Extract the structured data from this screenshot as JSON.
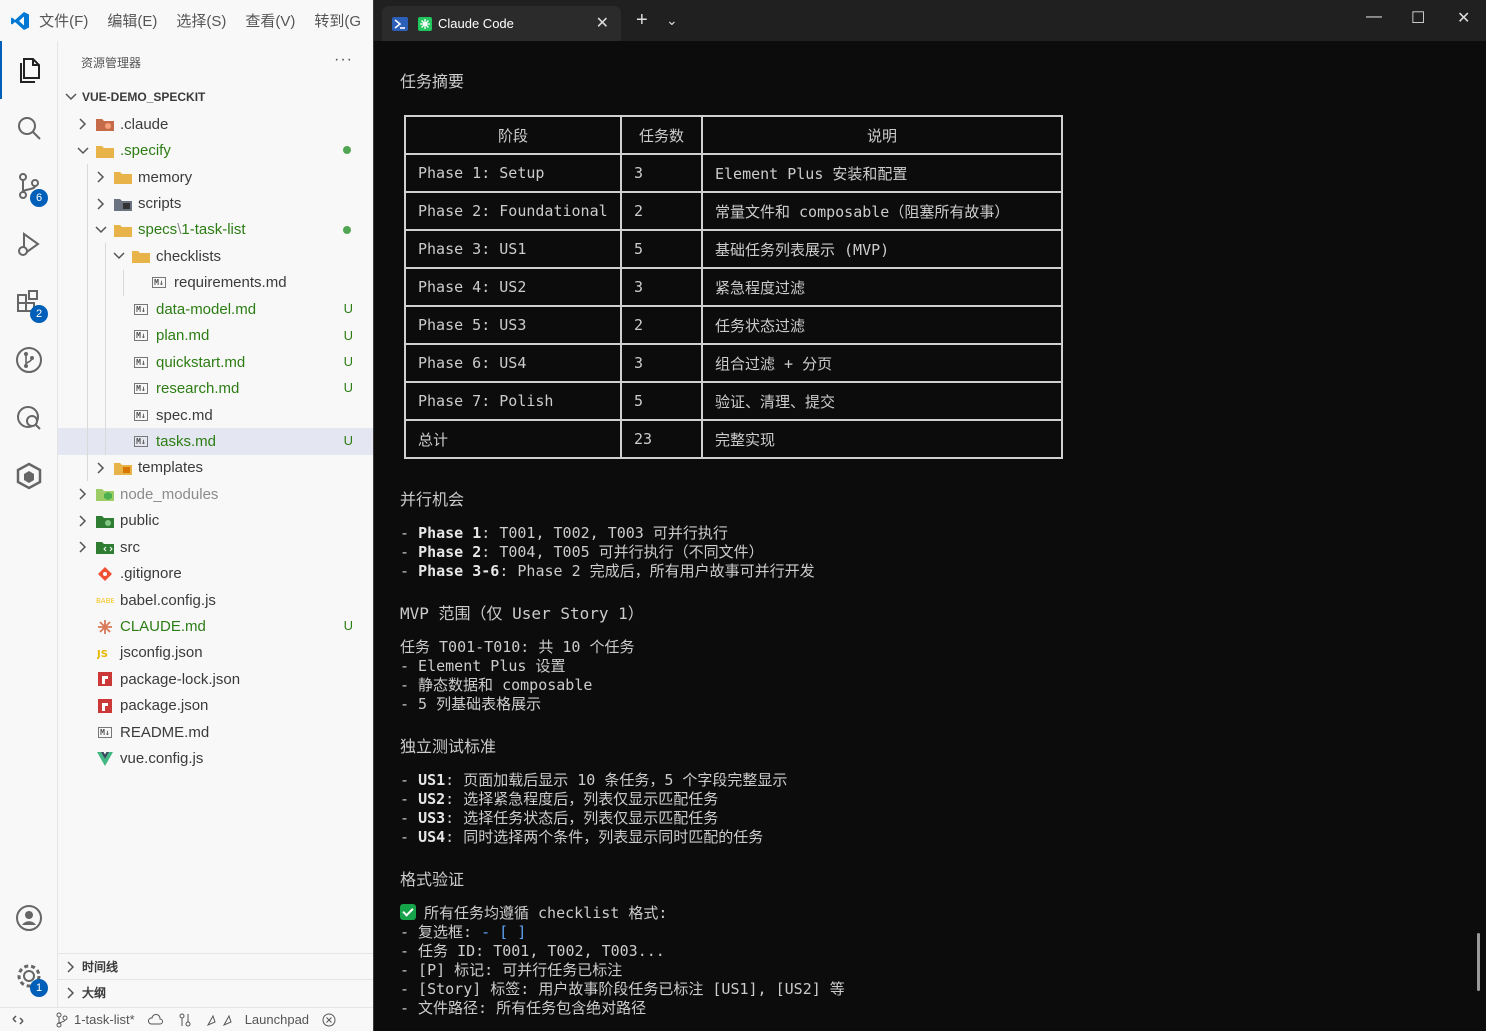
{
  "menu": [
    "文件(F)",
    "编辑(E)",
    "选择(S)",
    "查看(V)",
    "转到(G"
  ],
  "activity": {
    "source_control_badge": "6",
    "extensions_badge": "2",
    "settings_badge": "1"
  },
  "sidebar": {
    "title": "资源管理器",
    "more": "···",
    "root": "VUE-DEMO_SPECKIT",
    "tree": [
      {
        "label": ".claude",
        "depth": 1,
        "chev": "right",
        "icon": "claude-folder-icon",
        "color": "normal"
      },
      {
        "label": ".specify",
        "depth": 1,
        "chev": "down",
        "icon": "folder-icon",
        "color": "green",
        "dot": true
      },
      {
        "label": "memory",
        "depth": 2,
        "chev": "right",
        "icon": "folder-icon",
        "color": "muted"
      },
      {
        "label": "scripts",
        "depth": 2,
        "chev": "right",
        "icon": "scripts-folder-icon",
        "color": "muted"
      },
      {
        "label": "specs",
        "suffix": "1-task-list",
        "depth": 2,
        "chev": "down",
        "icon": "folder-icon",
        "color": "green",
        "dot": true
      },
      {
        "label": "checklists",
        "depth": 3,
        "chev": "down",
        "icon": "folder-icon",
        "color": "muted"
      },
      {
        "label": "requirements.md",
        "depth": 4,
        "chev": "none",
        "icon": "markdown-icon",
        "color": "muted"
      },
      {
        "label": "data-model.md",
        "depth": 3,
        "chev": "none",
        "icon": "markdown-icon",
        "color": "green",
        "badge": "U"
      },
      {
        "label": "plan.md",
        "depth": 3,
        "chev": "none",
        "icon": "markdown-icon",
        "color": "green",
        "badge": "U"
      },
      {
        "label": "quickstart.md",
        "depth": 3,
        "chev": "none",
        "icon": "markdown-icon",
        "color": "green",
        "badge": "U"
      },
      {
        "label": "research.md",
        "depth": 3,
        "chev": "none",
        "icon": "markdown-icon",
        "color": "green",
        "badge": "U"
      },
      {
        "label": "spec.md",
        "depth": 3,
        "chev": "none",
        "icon": "markdown-icon",
        "color": "muted"
      },
      {
        "label": "tasks.md",
        "depth": 3,
        "chev": "none",
        "icon": "markdown-icon",
        "color": "green",
        "badge": "U",
        "selected": true
      },
      {
        "label": "templates",
        "depth": 2,
        "chev": "right",
        "icon": "templates-folder-icon",
        "color": "muted"
      },
      {
        "label": "node_modules",
        "depth": 1,
        "chev": "right",
        "icon": "node-folder-icon",
        "color": "grey"
      },
      {
        "label": "public",
        "depth": 1,
        "chev": "right",
        "icon": "public-folder-icon",
        "color": "normal"
      },
      {
        "label": "src",
        "depth": 1,
        "chev": "right",
        "icon": "src-folder-icon",
        "color": "normal"
      },
      {
        "label": ".gitignore",
        "depth": 1,
        "chev": "none",
        "icon": "git-icon",
        "color": "normal"
      },
      {
        "label": "babel.config.js",
        "depth": 1,
        "chev": "none",
        "icon": "babel-icon",
        "color": "normal"
      },
      {
        "label": "CLAUDE.md",
        "depth": 1,
        "chev": "none",
        "icon": "claude-icon",
        "color": "green",
        "badge": "U"
      },
      {
        "label": "jsconfig.json",
        "depth": 1,
        "chev": "none",
        "icon": "js-icon",
        "color": "normal"
      },
      {
        "label": "package-lock.json",
        "depth": 1,
        "chev": "none",
        "icon": "npm-icon",
        "color": "normal"
      },
      {
        "label": "package.json",
        "depth": 1,
        "chev": "none",
        "icon": "npm-icon",
        "color": "normal"
      },
      {
        "label": "README.md",
        "depth": 1,
        "chev": "none",
        "icon": "markdown-icon",
        "color": "normal"
      },
      {
        "label": "vue.config.js",
        "depth": 1,
        "chev": "none",
        "icon": "vue-icon",
        "color": "normal"
      }
    ],
    "timeline": "时间线",
    "outline": "大纲"
  },
  "statusbar": {
    "branch": "1-task-list*",
    "launchpad": "Launchpad"
  },
  "terminal": {
    "tab_title": "Claude Code",
    "summary_title": "任务摘要",
    "table": {
      "headers": [
        "阶段",
        "任务数",
        "说明"
      ],
      "rows": [
        [
          "Phase 1: Setup",
          "3",
          "Element Plus 安装和配置"
        ],
        [
          "Phase 2: Foundational",
          "2",
          "常量文件和 composable（阻塞所有故事）"
        ],
        [
          "Phase 3: US1",
          "5",
          "基础任务列表展示 (MVP)"
        ],
        [
          "Phase 4: US2",
          "3",
          "紧急程度过滤"
        ],
        [
          "Phase 5: US3",
          "2",
          "任务状态过滤"
        ],
        [
          "Phase 6: US4",
          "3",
          "组合过滤 + 分页"
        ],
        [
          "Phase 7: Polish",
          "5",
          "验证、清理、提交"
        ],
        [
          "总计",
          "23",
          "完整实现"
        ]
      ]
    },
    "parallel_title": "并行机会",
    "parallel": [
      {
        "bold": "Phase 1",
        "rest": ": T001, T002, T003 可并行执行"
      },
      {
        "bold": "Phase 2",
        "rest": ": T004, T005 可并行执行（不同文件）"
      },
      {
        "bold": "Phase 3-6",
        "rest": ": Phase 2 完成后，所有用户故事可并行开发"
      }
    ],
    "mvp_title": "MVP 范围（仅 User Story 1）",
    "mvp_intro": "任务 T001-T010: 共 10 个任务",
    "mvp_items": [
      "- Element Plus 设置",
      "- 静态数据和 composable",
      "- 5 列基础表格展示"
    ],
    "test_title": "独立测试标准",
    "tests": [
      {
        "bold": "US1",
        "rest": ": 页面加载后显示 10 条任务，5 个字段完整显示"
      },
      {
        "bold": "US2",
        "rest": ": 选择紧急程度后，列表仅显示匹配任务"
      },
      {
        "bold": "US3",
        "rest": ": 选择任务状态后，列表仅显示匹配任务"
      },
      {
        "bold": "US4",
        "rest": ": 同时选择两个条件，列表显示同时匹配的任务"
      }
    ],
    "format_title": "格式验证",
    "format_intro": "所有任务均遵循 checklist 格式:",
    "format_checkbox_label": "- 复选框:",
    "format_checkbox_value": "- [ ]",
    "format_items": [
      "- 任务 ID: T001, T002, T003...",
      "- [P] 标记: 可并行任务已标注",
      "- [Story] 标签: 用户故事阶段任务已标注 [US1], [US2] 等",
      "- 文件路径: 所有任务包含绝对路径"
    ]
  }
}
